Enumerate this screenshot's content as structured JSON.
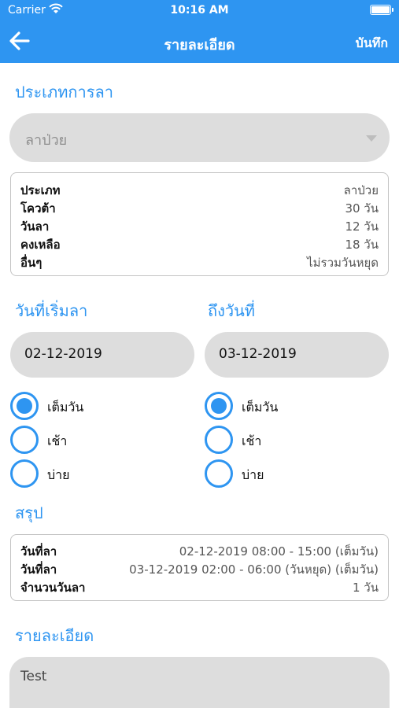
{
  "status_bar": {
    "carrier": "Carrier",
    "time": "10:16 AM"
  },
  "nav": {
    "title": "รายละเอียด",
    "save_label": "บันทึก",
    "back_icon": "arrow-left-icon"
  },
  "colors": {
    "accent": "#2e95f1",
    "field_bg": "#dddddd",
    "box_border": "#c4c4c4"
  },
  "leave_type": {
    "label": "ประเภทการลา",
    "selected": "ลาป่วย"
  },
  "quota": {
    "rows": [
      {
        "key": "ประเภท",
        "value": "ลาป่วย"
      },
      {
        "key": "โควต้า",
        "value": "30 วัน"
      },
      {
        "key": "วันลา",
        "value": "12 วัน"
      },
      {
        "key": "คงเหลือ",
        "value": "18 วัน"
      },
      {
        "key": "อื่นๆ",
        "value": "ไม่รวมวันหยุด"
      }
    ]
  },
  "start": {
    "label": "วันที่เริ่มลา",
    "date": "02-12-2019",
    "options": [
      "เต็มวัน",
      "เช้า",
      "บ่าย"
    ],
    "selected_index": 0
  },
  "end": {
    "label": "ถึงวันที่",
    "date": "03-12-2019",
    "options": [
      "เต็มวัน",
      "เช้า",
      "บ่าย"
    ],
    "selected_index": 0
  },
  "summary": {
    "label": "สรุป",
    "rows": [
      {
        "key": "วันที่ลา",
        "value": "02-12-2019 08:00 - 15:00 (เต็มวัน)"
      },
      {
        "key": "วันที่ลา",
        "value": "03-12-2019 02:00 - 06:00 (วันหยุด) (เต็มวัน)"
      },
      {
        "key": "จำนวนวันลา",
        "value": "1 วัน"
      }
    ]
  },
  "detail": {
    "label": "รายละเอียด",
    "value": "Test"
  }
}
